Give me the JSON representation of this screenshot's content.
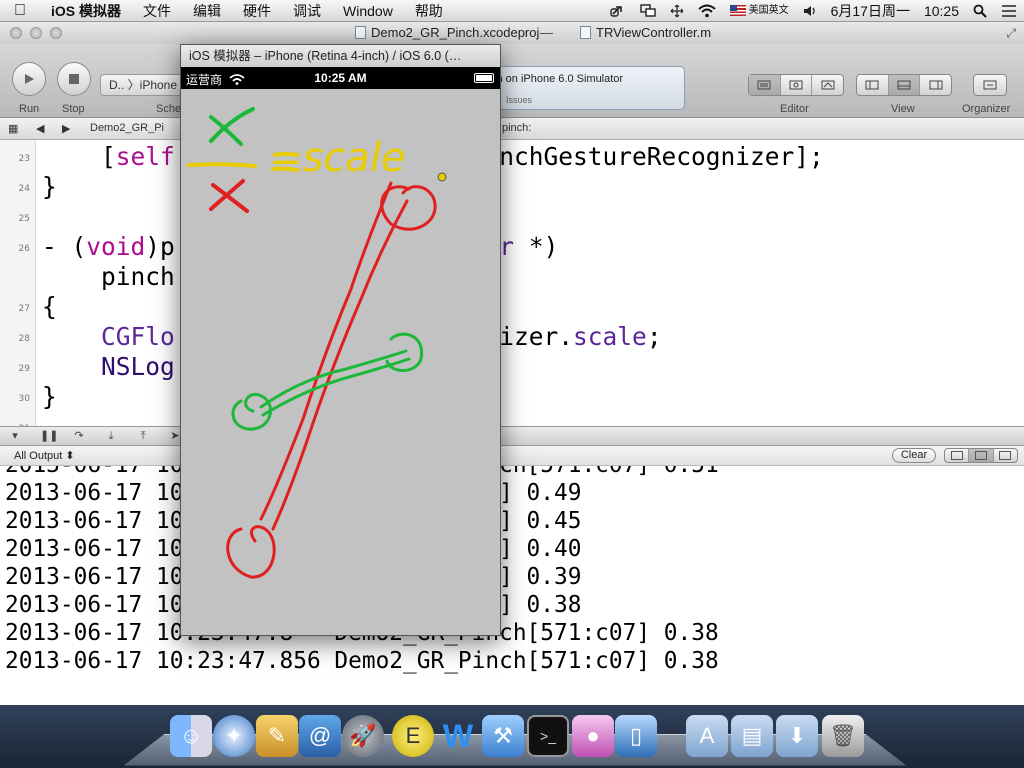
{
  "menubar": {
    "apple": "",
    "app_name": "iOS 模拟器",
    "items": [
      "文件",
      "编辑",
      "硬件",
      "调试",
      "Window",
      "帮助"
    ],
    "input_method": "美国英文",
    "date": "6月17日周一",
    "time": "10:25"
  },
  "xcode": {
    "window_title": "Demo2_GR_Pinch.xcodeproj",
    "dash": "—",
    "file_title": "TRViewController.m",
    "toolbar": {
      "run_label": "Run",
      "stop_label": "Stop",
      "scheme_text": "D.. 〉iPhone",
      "scheme_label": "Sche",
      "activity_text": "ch on iPhone 6.0 Simulator",
      "issues_label": "Issues",
      "editor_label": "Editor",
      "view_label": "View",
      "organizer_label": "Organizer"
    },
    "jumpbar": {
      "file": "Demo2_GR_Pi",
      "method": "pinch:"
    },
    "code_lines": [
      {
        "num": "23",
        "parts": [
          [
            "plain",
            "    ["
          ],
          [
            "kw",
            "self"
          ],
          [
            "plain",
            "             gnizer:pinchGestureRecognizer];"
          ]
        ]
      },
      {
        "num": "24",
        "parts": [
          [
            "plain",
            "}"
          ]
        ]
      },
      {
        "num": "25",
        "parts": [
          [
            "plain",
            ""
          ]
        ]
      },
      {
        "num": "26",
        "parts": [
          [
            "plain",
            "- ("
          ],
          [
            "kw",
            "void"
          ],
          [
            "plain",
            ")p             "
          ],
          [
            "cls",
            "Recognizer"
          ],
          [
            "plain",
            " *)"
          ]
        ]
      },
      {
        "num": "",
        "parts": [
          [
            "plain",
            "    pinch"
          ]
        ]
      },
      {
        "num": "27",
        "parts": [
          [
            "plain",
            "{"
          ]
        ]
      },
      {
        "num": "28",
        "parts": [
          [
            "plain",
            "    "
          ],
          [
            "cls",
            "CGFlo"
          ],
          [
            "plain",
            "             ureRecognizer."
          ],
          [
            "cls",
            "scale"
          ],
          [
            "plain",
            ";"
          ]
        ]
      },
      {
        "num": "29",
        "parts": [
          [
            "plain",
            "    "
          ],
          [
            "mth",
            "NSLog"
          ]
        ]
      },
      {
        "num": "30",
        "parts": [
          [
            "plain",
            "}"
          ]
        ]
      },
      {
        "num": "31",
        "parts": [
          [
            "plain",
            ""
          ]
        ]
      }
    ],
    "console": {
      "filter": "All Output ⬍",
      "clear_label": "Clear",
      "lines": [
        "2013-06-17 10:23:47.8   Demo2_GR_Pinch[571:c07] 0.51",
        "2013-06-17 10          Pinch[571:c07] 0.49",
        "2013-06-17 10          Pinch[571:c07] 0.45",
        "2013-06-17 10          Pinch[571:c07] 0.40",
        "2013-06-17 10          Pinch[571:c07] 0.39",
        "2013-06-17 10          Pinch[571:c07] 0.38",
        "2013-06-17 10:23:47.8   Demo2_GR_Pinch[571:c07] 0.38",
        "2013-06-17 10:23:47.856 Demo2_GR_Pinch[571:c07] 0.38"
      ]
    }
  },
  "simulator": {
    "title": "iOS 模拟器 – iPhone (Retina 4-inch) / iOS 6.0 (…",
    "carrier": "运营商",
    "time": "10:25 AM",
    "annotation": {
      "numerator": "x",
      "denominator": "x",
      "equals_scale": "=scale"
    }
  },
  "dock": {
    "icons": [
      "finder-icon",
      "safari-icon",
      "preview-icon",
      "mail-icon",
      "launchpad-icon",
      "textedit-icon",
      "word-icon",
      "xcode-icon",
      "terminal-icon",
      "instruments-icon",
      "simulator-icon",
      "applications-folder-icon",
      "documents-folder-icon",
      "downloads-folder-icon",
      "trash-icon"
    ]
  }
}
